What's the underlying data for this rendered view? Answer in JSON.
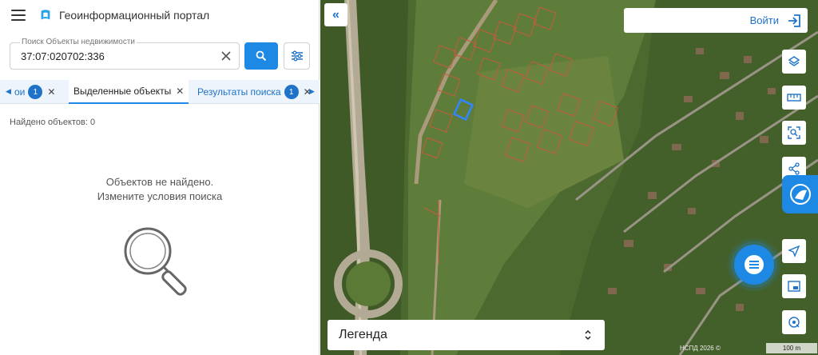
{
  "app": {
    "title": "Геоинформационный портал"
  },
  "search": {
    "label": "Поиск Объекты недвижимости",
    "value": "37:07:020702:336"
  },
  "tabs": [
    {
      "label": "ои",
      "badge": "1"
    },
    {
      "label": "Выделенные объекты"
    },
    {
      "label": "Результаты поиска",
      "badge": "1"
    }
  ],
  "results": {
    "found_text": "Найдено объектов: 0",
    "empty_line1": "Объектов не найдено.",
    "empty_line2": "Измените условия поиска"
  },
  "map": {
    "login_label": "Войти",
    "legend_label": "Легенда",
    "attribution": "НСПД 2026 ©",
    "scale_label": "100 m"
  },
  "icons": {
    "menu": "hamburger-menu-icon",
    "logo": "portal-logo-icon",
    "clear": "close-icon",
    "search": "search-icon",
    "filter": "filter-sliders-icon",
    "collapse": "double-chevron-left-icon",
    "login": "login-arrow-icon",
    "layers": "layers-icon",
    "ruler": "ruler-icon",
    "select_area": "select-area-icon",
    "share": "share-icon",
    "brand": "brand-logo-icon",
    "chat": "chat-icon",
    "navigate": "navigation-arrow-icon",
    "pip": "picture-in-picture-icon",
    "location": "location-pin-icon",
    "legend_toggle": "chevron-up-down-icon"
  },
  "colors": {
    "accent": "#1e88e5",
    "link": "#1e73c9",
    "parcel_outline": "#c85a3a",
    "selected_parcel": "#2f86ff"
  }
}
